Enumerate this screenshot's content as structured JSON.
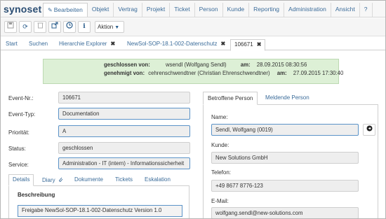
{
  "app": {
    "logo": "synoset"
  },
  "menu": {
    "items": [
      {
        "label": "Bearbeiten",
        "icon": "edit-icon",
        "active": true
      },
      {
        "label": "Objekt"
      },
      {
        "label": "Vertrag"
      },
      {
        "label": "Projekt"
      },
      {
        "label": "Ticket"
      },
      {
        "label": "Person"
      },
      {
        "label": "Kunde"
      },
      {
        "label": "Reporting"
      },
      {
        "label": "Administration"
      },
      {
        "label": "Ansicht"
      },
      {
        "label": "?"
      }
    ]
  },
  "toolbar": {
    "icons": [
      "save-icon",
      "refresh-icon",
      "delete-icon",
      "export-icon",
      "history-icon",
      "info-icon"
    ],
    "action_label": "Aktion"
  },
  "tabs": [
    {
      "label": "Start",
      "closable": false
    },
    {
      "label": "Suchen",
      "closable": false
    },
    {
      "label": "Hierarchie Explorer",
      "closable": true
    },
    {
      "label": "NewSol-SOP-18.1-002-Datenschutz",
      "closable": true
    },
    {
      "label": "106671",
      "closable": true,
      "active": true
    }
  ],
  "banner": {
    "closed_label": "geschlossen von:",
    "closed_by": "wsendl (Wolfgang Sendl)",
    "closed_am_label": "am:",
    "closed_at": "28.09.2015 08:30:56",
    "approved_label": "genehmigt von:",
    "approved_by": "cehrenschwendtner (Christian Ehrenschwendtner)",
    "approved_am_label": "am:",
    "approved_at": "27.09.2015 17:30:40"
  },
  "form": {
    "event_nr_label": "Event-Nr.:",
    "event_nr": "106671",
    "event_type_label": "Event-Typ:",
    "event_type": "Documentation",
    "priority_label": "Priorität:",
    "priority": "A",
    "status_label": "Status:",
    "status": "geschlossen",
    "service_label": "Service:",
    "service": "Administration - IT (intern) - Informationssicherheit"
  },
  "detail_tabs": [
    {
      "label": "Details",
      "active": true
    },
    {
      "label": "Diary",
      "icon": "paperclip-icon"
    },
    {
      "label": "Dokumente"
    },
    {
      "label": "Tickets"
    },
    {
      "label": "Eskalation"
    }
  ],
  "description": {
    "label": "Beschreibung",
    "value": "Freigabe NewSol-SOP-18.1-002-Datenschutz Version 1.0"
  },
  "person_tabs": [
    {
      "label": "Betroffene Person",
      "active": true
    },
    {
      "label": "Meldende Person"
    }
  ],
  "person": {
    "name_label": "Name:",
    "name": "Sendl, Wolfgang (0019)",
    "customer_label": "Kunde:",
    "customer": "New Solutions GmbH",
    "phone_label": "Telefon:",
    "phone": "+49 8677 8776-123",
    "email_label": "E-Mail:",
    "email": "wolfgang.sendl@new-solutions.com"
  }
}
